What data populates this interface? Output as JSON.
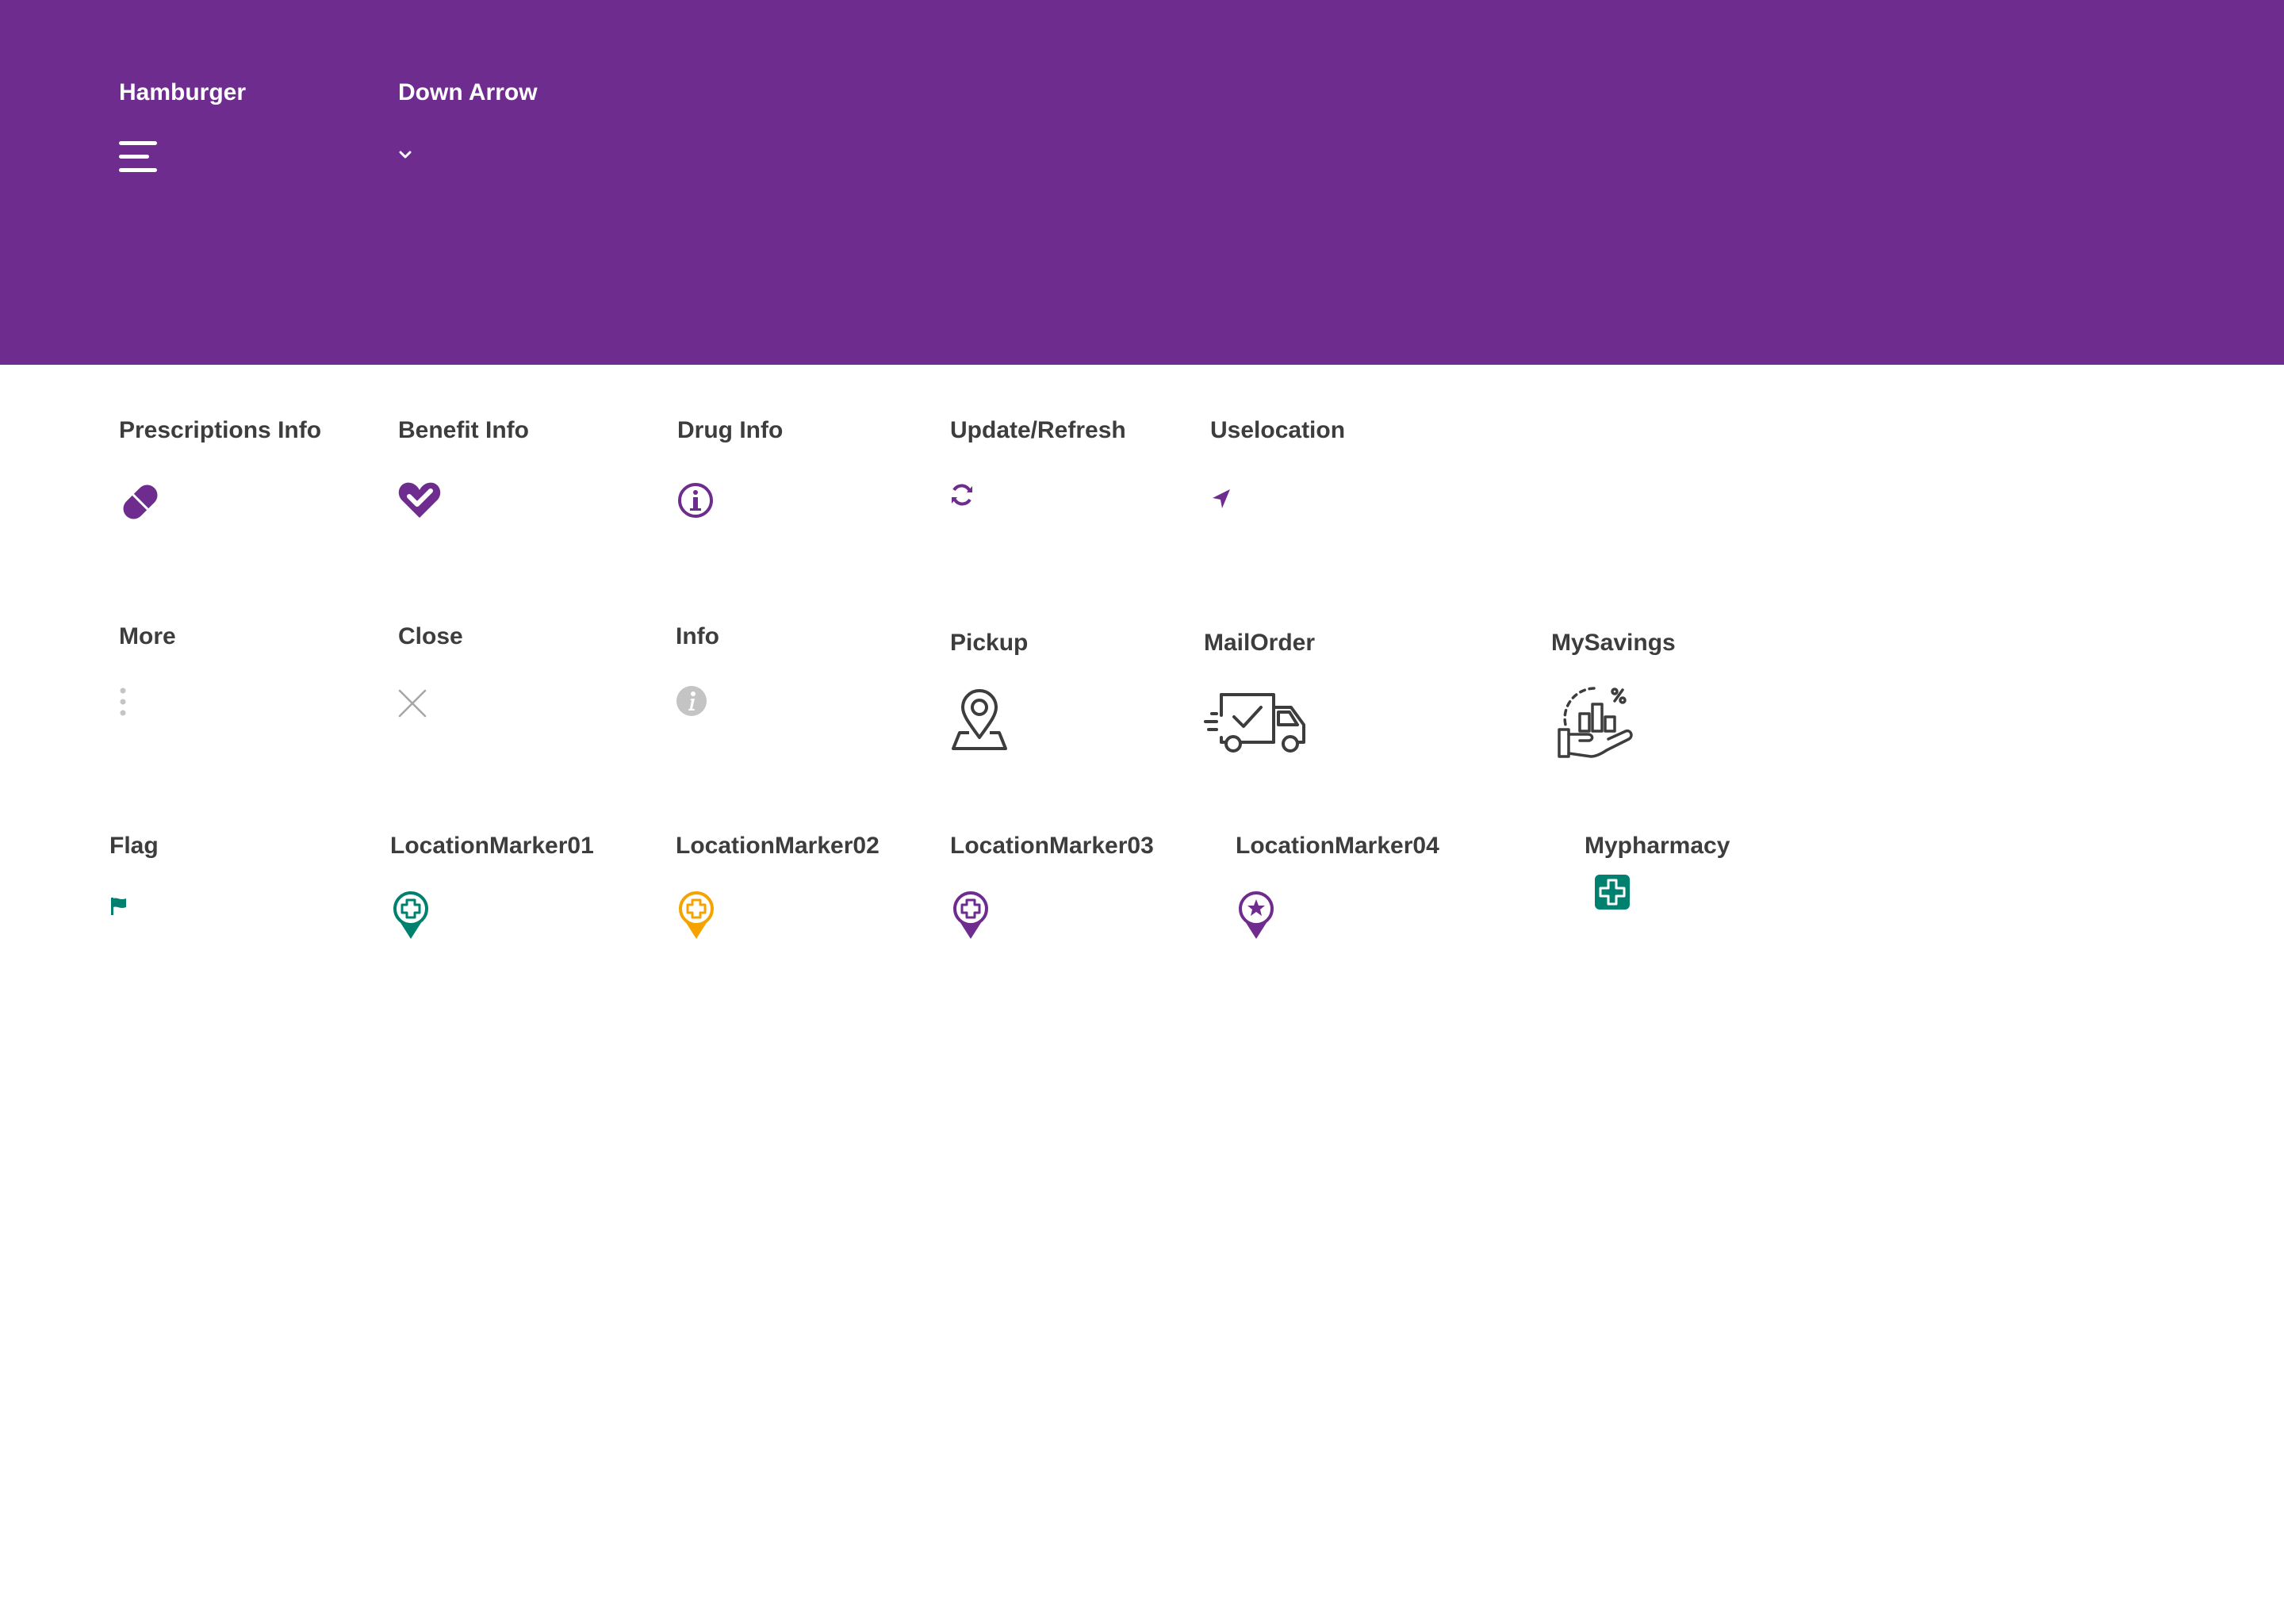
{
  "colors": {
    "header_bg": "#6f2c8f",
    "primary_purple": "#6f2c8f",
    "teal": "#00806e",
    "orange": "#f5a300",
    "gray_icon": "#c4c4c4",
    "dark_icon": "#3d3d3d"
  },
  "header": {
    "items": [
      {
        "label": "Hamburger",
        "icon": "hamburger-icon"
      },
      {
        "label": "Down Arrow",
        "icon": "chevron-down-icon"
      }
    ]
  },
  "row1": [
    {
      "label": "Prescriptions Info",
      "icon": "pill-icon"
    },
    {
      "label": "Benefit Info",
      "icon": "heart-check-icon"
    },
    {
      "label": "Drug Info",
      "icon": "info-circle-icon"
    },
    {
      "label": "Update/Refresh",
      "icon": "refresh-icon"
    },
    {
      "label": "Uselocation",
      "icon": "location-arrow-icon"
    }
  ],
  "row2": [
    {
      "label": "More",
      "icon": "more-vertical-icon"
    },
    {
      "label": "Close",
      "icon": "close-icon"
    },
    {
      "label": "Info",
      "icon": "info-filled-icon"
    },
    {
      "label": "Pickup",
      "icon": "pickup-map-pin-icon"
    },
    {
      "label": "MailOrder",
      "icon": "delivery-truck-icon"
    },
    {
      "label": "MySavings",
      "icon": "savings-hand-icon"
    }
  ],
  "row3": [
    {
      "label": "Flag",
      "icon": "flag-icon"
    },
    {
      "label": "LocationMarker01",
      "icon": "location-marker-teal-icon"
    },
    {
      "label": "LocationMarker02",
      "icon": "location-marker-orange-icon"
    },
    {
      "label": "LocationMarker03",
      "icon": "location-marker-purple-icon"
    },
    {
      "label": "LocationMarker04",
      "icon": "location-marker-star-icon"
    },
    {
      "label": "Mypharmacy",
      "icon": "pharmacy-cross-icon"
    }
  ]
}
